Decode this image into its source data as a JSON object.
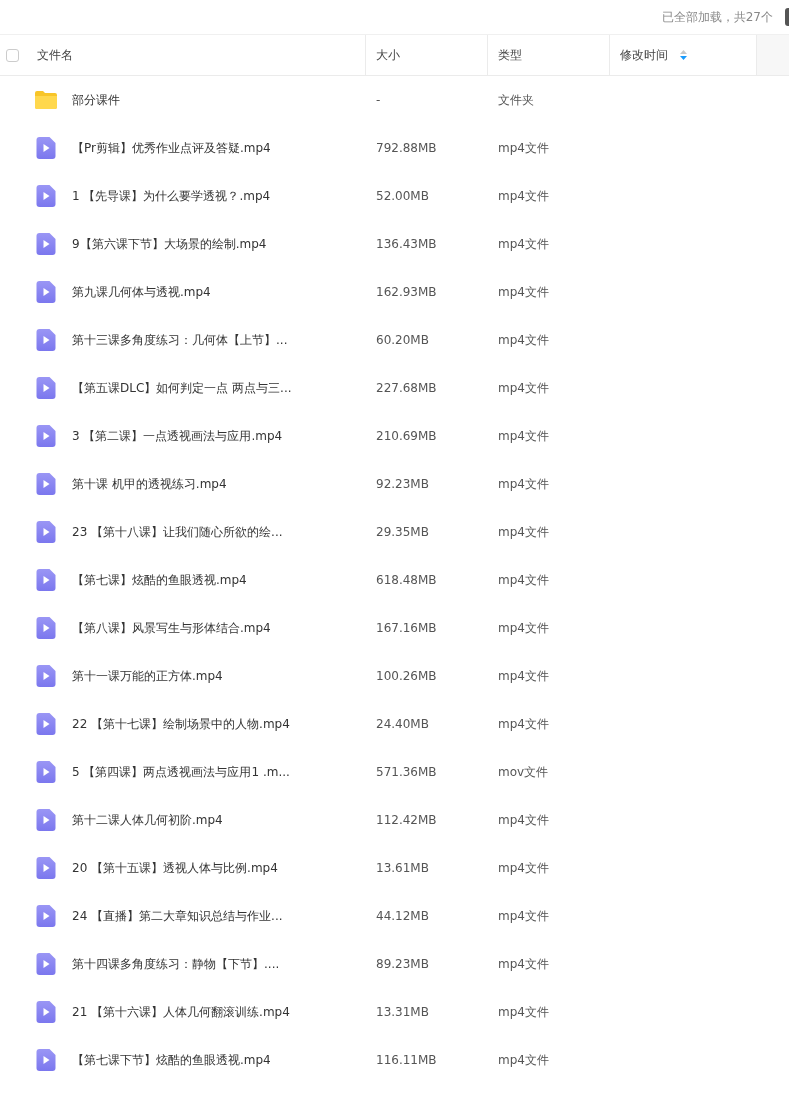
{
  "status": "已全部加载，共27个",
  "columns": [
    {
      "label": "文件名"
    },
    {
      "label": "大小"
    },
    {
      "label": "类型"
    },
    {
      "label": "修改时间",
      "sortable": true
    }
  ],
  "select_all": {
    "checked": false
  },
  "rows": [
    {
      "kind": "folder",
      "name": "部分课件",
      "size": "-",
      "type": "文件夹"
    },
    {
      "kind": "video",
      "name": "【Pr剪辑】优秀作业点评及答疑.mp4",
      "size": "792.88MB",
      "type": "mp4文件"
    },
    {
      "kind": "video",
      "name": "1 【先导课】为什么要学透视？.mp4",
      "size": "52.00MB",
      "type": "mp4文件"
    },
    {
      "kind": "video",
      "name": "9【第六课下节】大场景的绘制.mp4",
      "size": "136.43MB",
      "type": "mp4文件"
    },
    {
      "kind": "video",
      "name": "第九课几何体与透视.mp4",
      "size": "162.93MB",
      "type": "mp4文件"
    },
    {
      "kind": "video",
      "name": "第十三课多角度练习：几何体【上节】...",
      "size": "60.20MB",
      "type": "mp4文件"
    },
    {
      "kind": "video",
      "name": "【第五课DLC】如何判定一点 两点与三...",
      "size": "227.68MB",
      "type": "mp4文件"
    },
    {
      "kind": "video",
      "name": "3 【第二课】一点透视画法与应用.mp4",
      "size": "210.69MB",
      "type": "mp4文件"
    },
    {
      "kind": "video",
      "name": "第十课 机甲的透视练习.mp4",
      "size": "92.23MB",
      "type": "mp4文件"
    },
    {
      "kind": "video",
      "name": "23 【第十八课】让我们随心所欲的绘...",
      "size": "29.35MB",
      "type": "mp4文件"
    },
    {
      "kind": "video",
      "name": "【第七课】炫酷的鱼眼透视.mp4",
      "size": "618.48MB",
      "type": "mp4文件"
    },
    {
      "kind": "video",
      "name": "【第八课】风景写生与形体结合.mp4",
      "size": "167.16MB",
      "type": "mp4文件"
    },
    {
      "kind": "video",
      "name": "第十一课万能的正方体.mp4",
      "size": "100.26MB",
      "type": "mp4文件"
    },
    {
      "kind": "video",
      "name": "22 【第十七课】绘制场景中的人物.mp4",
      "size": "24.40MB",
      "type": "mp4文件"
    },
    {
      "kind": "video",
      "name": "5 【第四课】两点透视画法与应用1 .m...",
      "size": "571.36MB",
      "type": "mov文件"
    },
    {
      "kind": "video",
      "name": "第十二课人体几何初阶.mp4",
      "size": "112.42MB",
      "type": "mp4文件"
    },
    {
      "kind": "video",
      "name": "20 【第十五课】透视人体与比例.mp4",
      "size": "13.61MB",
      "type": "mp4文件"
    },
    {
      "kind": "video",
      "name": "24 【直播】第二大章知识总结与作业...",
      "size": "44.12MB",
      "type": "mp4文件"
    },
    {
      "kind": "video",
      "name": "第十四课多角度练习：静物【下节】....",
      "size": "89.23MB",
      "type": "mp4文件"
    },
    {
      "kind": "video",
      "name": "21 【第十六课】人体几何翻滚训练.mp4",
      "size": "13.31MB",
      "type": "mp4文件"
    },
    {
      "kind": "video",
      "name": "【第七课下节】炫酷的鱼眼透视.mp4",
      "size": "116.11MB",
      "type": "mp4文件"
    }
  ]
}
